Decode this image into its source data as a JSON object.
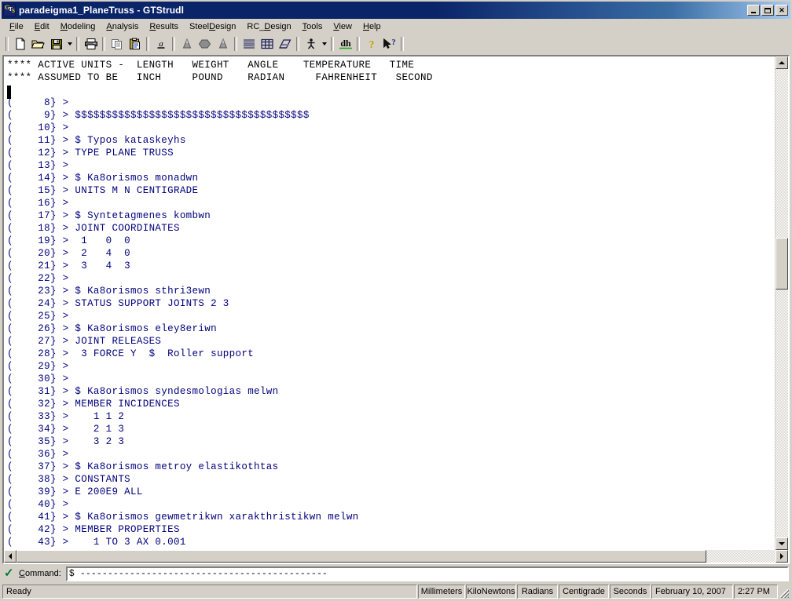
{
  "window": {
    "title": "paradeigma1_PlaneTruss - GTStrudl",
    "app_icon": "gtstrudl-icon",
    "buttons": {
      "minimize": "Minimize",
      "maximize": "Maximize",
      "close": "Close"
    }
  },
  "menubar": {
    "items": [
      {
        "label": "File",
        "accel_index": 0
      },
      {
        "label": "Edit",
        "accel_index": 0
      },
      {
        "label": "Modeling",
        "accel_index": 0
      },
      {
        "label": "Analysis",
        "accel_index": 0
      },
      {
        "label": "Results",
        "accel_index": 0
      },
      {
        "label": "SteelDesign",
        "accel_index": 5
      },
      {
        "label": "RC_Design",
        "accel_index": 3
      },
      {
        "label": "Tools",
        "accel_index": 0
      },
      {
        "label": "View",
        "accel_index": 0
      },
      {
        "label": "Help",
        "accel_index": 0
      }
    ]
  },
  "toolbar": {
    "buttons": [
      {
        "name": "new-icon",
        "tooltip": "New"
      },
      {
        "name": "open-folder-icon",
        "tooltip": "Open"
      },
      {
        "name": "save-disk-icon",
        "tooltip": "Save"
      },
      {
        "name": "save-dropdown-arrow",
        "tooltip": "Save options"
      },
      {
        "name": "print-icon",
        "tooltip": "Print"
      },
      {
        "name": "copy-icon",
        "tooltip": "Copy"
      },
      {
        "name": "paste-icon",
        "tooltip": "Paste"
      },
      {
        "name": "font-a-icon",
        "tooltip": "Font"
      },
      {
        "name": "model-left-icon",
        "tooltip": "Model view"
      },
      {
        "name": "solid-shape-icon",
        "tooltip": "Shape"
      },
      {
        "name": "model-right-icon",
        "tooltip": "Model view"
      },
      {
        "name": "lines-list-icon",
        "tooltip": "Output list"
      },
      {
        "name": "table-grid-icon",
        "tooltip": "Table"
      },
      {
        "name": "geometry-icon",
        "tooltip": "Geometry"
      },
      {
        "name": "stickman-icon",
        "tooltip": "Stick figure"
      },
      {
        "name": "stickman-dropdown-arrow",
        "tooltip": "Stick figure options"
      },
      {
        "name": "dh-underline-icon",
        "tooltip": "dh"
      },
      {
        "name": "help-question-icon",
        "tooltip": "Help"
      },
      {
        "name": "context-help-icon",
        "tooltip": "Context help"
      }
    ]
  },
  "output": {
    "header_lines": [
      "**** ACTIVE UNITS -  LENGTH   WEIGHT   ANGLE    TEMPERATURE   TIME",
      "**** ASSUMED TO BE   INCH     POUND    RADIAN     FAHRENHEIT   SECOND"
    ],
    "lines": [
      {
        "num": "8",
        "text": ""
      },
      {
        "num": "9",
        "text": "$$$$$$$$$$$$$$$$$$$$$$$$$$$$$$$$$$$$$$"
      },
      {
        "num": "10",
        "text": ""
      },
      {
        "num": "11",
        "text": "$ Typos kataskeyhs"
      },
      {
        "num": "12",
        "text": "TYPE PLANE TRUSS"
      },
      {
        "num": "13",
        "text": ""
      },
      {
        "num": "14",
        "text": "$ Ka8orismos monadwn"
      },
      {
        "num": "15",
        "text": "UNITS M N CENTIGRADE"
      },
      {
        "num": "16",
        "text": ""
      },
      {
        "num": "17",
        "text": "$ Syntetagmenes kombwn"
      },
      {
        "num": "18",
        "text": "JOINT COORDINATES"
      },
      {
        "num": "19",
        "text": " 1   0  0"
      },
      {
        "num": "20",
        "text": " 2   4  0"
      },
      {
        "num": "21",
        "text": " 3   4  3"
      },
      {
        "num": "22",
        "text": ""
      },
      {
        "num": "23",
        "text": "$ Ka8orismos sthri3ewn"
      },
      {
        "num": "24",
        "text": "STATUS SUPPORT JOINTS 2 3"
      },
      {
        "num": "25",
        "text": ""
      },
      {
        "num": "26",
        "text": "$ Ka8orismos eley8eriwn"
      },
      {
        "num": "27",
        "text": "JOINT RELEASES"
      },
      {
        "num": "28",
        "text": " 3 FORCE Y  $  Roller support"
      },
      {
        "num": "29",
        "text": ""
      },
      {
        "num": "30",
        "text": ""
      },
      {
        "num": "31",
        "text": "$ Ka8orismos syndesmologias melwn"
      },
      {
        "num": "32",
        "text": "MEMBER INCIDENCES"
      },
      {
        "num": "33",
        "text": "   1 1 2"
      },
      {
        "num": "34",
        "text": "   2 1 3"
      },
      {
        "num": "35",
        "text": "   3 2 3"
      },
      {
        "num": "36",
        "text": ""
      },
      {
        "num": "37",
        "text": "$ Ka8orismos metroy elastikothtas"
      },
      {
        "num": "38",
        "text": "CONSTANTS"
      },
      {
        "num": "39",
        "text": "E 200E9 ALL"
      },
      {
        "num": "40",
        "text": ""
      },
      {
        "num": "41",
        "text": "$ Ka8orismos gewmetrikwn xarakthristikwn melwn"
      },
      {
        "num": "42",
        "text": "MEMBER PROPERTIES"
      },
      {
        "num": "43",
        "text": "   1 TO 3 AX 0.001"
      }
    ],
    "text_color": "#00007b",
    "header_color": "#000000"
  },
  "scrollbars": {
    "vertical": {
      "thumb_top_pct": 36,
      "thumb_height_pct": 11
    },
    "horizontal": {
      "thumb_left_pct": 0,
      "thumb_width_pct": 88
    }
  },
  "command_bar": {
    "check_icon": "green-check-icon",
    "label": "Command:",
    "value": "$ ---------------------------------------------",
    "placeholder": ""
  },
  "statusbar": {
    "ready_text": "Ready",
    "panels": [
      "Millimeters",
      "KiloNewtons",
      "Radians",
      "Centigrade",
      "Seconds"
    ],
    "date": "February 10, 2007",
    "time": "2:27 PM"
  }
}
